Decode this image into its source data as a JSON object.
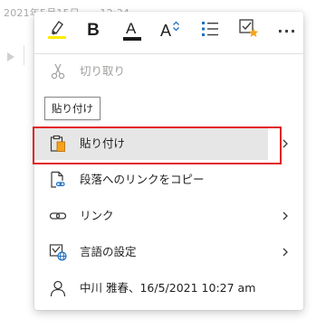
{
  "background": {
    "timestamp": "2021年5月15日　　12:34"
  },
  "toolbar": {
    "highlight_tooltip": "",
    "bold_label": "B",
    "font_color_label": "A",
    "font_size_label": "A",
    "more_label": "···",
    "colors": {
      "highlight_bar": "#ffeb00",
      "font_color_bar": "#1a1a1a",
      "accent_blue": "#1c6fc1",
      "star_orange": "#f7a21b"
    }
  },
  "menu": {
    "cut_label": "切り取り",
    "paste_tooltip": "貼り付け",
    "paste_label": "貼り付け",
    "copy_link_label": "段落へのリンクをコピー",
    "link_label": "リンク",
    "language_label": "言語の設定",
    "author_label": "中川 雅春、16/5/2021 10:27 am"
  },
  "icons": {
    "highlighter": "highlighter-icon",
    "bold": "bold-icon",
    "font_color": "font-color-icon",
    "font_size": "font-size-icon",
    "list": "bullet-list-icon",
    "tag": "tag-icon",
    "more": "more-icon",
    "cut": "scissors-icon",
    "paste": "clipboard-icon",
    "copy_link": "page-link-icon",
    "link": "link-icon",
    "language": "language-icon",
    "author": "person-icon",
    "chevron": "chevron-right-icon"
  }
}
